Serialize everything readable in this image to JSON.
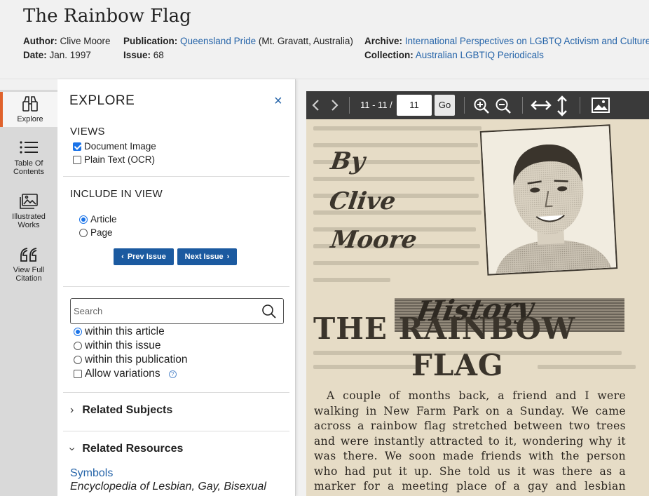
{
  "header": {
    "title": "The Rainbow Flag",
    "author_label": "Author:",
    "author": "Clive Moore",
    "date_label": "Date:",
    "date": "Jan. 1997",
    "publication_label": "Publication:",
    "publication": "Queensland Pride",
    "publication_place": "(Mt. Gravatt, Australia)",
    "issue_label": "Issue:",
    "issue": "68",
    "archive_label": "Archive:",
    "archive": "International Perspectives on LGBTQ Activism and Culture",
    "collection_label": "Collection:",
    "collection": "Australian LGBTIQ Periodicals"
  },
  "rail": {
    "items": [
      {
        "label": "Explore",
        "icon": "binoculars-icon",
        "active": true
      },
      {
        "label_line1": "Table Of",
        "label_line2": "Contents",
        "icon": "list-icon"
      },
      {
        "label_line1": "Illustrated",
        "label_line2": "Works",
        "icon": "images-icon"
      },
      {
        "label_line1": "View Full",
        "label_line2": "Citation",
        "icon": "quote-icon"
      }
    ]
  },
  "panel": {
    "title": "EXPLORE",
    "close": "×",
    "views_label": "VIEWS",
    "views": [
      {
        "label": "Document Image",
        "checked": true
      },
      {
        "label": "Plain Text (OCR)",
        "checked": false
      }
    ],
    "include_label": "INCLUDE IN VIEW",
    "include": [
      {
        "label": "Article",
        "checked": true
      },
      {
        "label": "Page",
        "checked": false
      }
    ],
    "prev_issue": "Prev Issue",
    "next_issue": "Next Issue",
    "search_placeholder": "Search",
    "search_scope": [
      {
        "label": "within this article",
        "checked": true
      },
      {
        "label": "within this issue",
        "checked": false
      },
      {
        "label": "within this publication",
        "checked": false
      }
    ],
    "allow_variations": "Allow variations",
    "help": "?",
    "related_subjects": "Related Subjects",
    "related_resources": "Related Resources",
    "resource_link": "Symbols",
    "resource_source": "Encyclopedia of Lesbian, Gay, Bisexual"
  },
  "viewer": {
    "page_range": "11 - 11 /",
    "page_value": "11",
    "go": "Go",
    "doc": {
      "byline_1": "By",
      "byline_2": "Clive",
      "byline_3": "Moore",
      "section": "History",
      "headline_1": "THE RAINBOW",
      "headline_2": "FLAG",
      "body": "A couple of months back, a friend and I were walking in New Farm Park on a Sunday. We came across a rainbow flag stretched between two trees and were instantly attracted to it, wondering why it was there. We soon made friends with the person who had put it up. She told us it was there as a marker for a meeting place of a gay and lesbian group."
    }
  },
  "colors": {
    "accent": "#e0622c",
    "link": "#2463a8",
    "button": "#1b5aa0",
    "toolbar": "#3a3a3a",
    "paper": "#e6dcc6"
  }
}
